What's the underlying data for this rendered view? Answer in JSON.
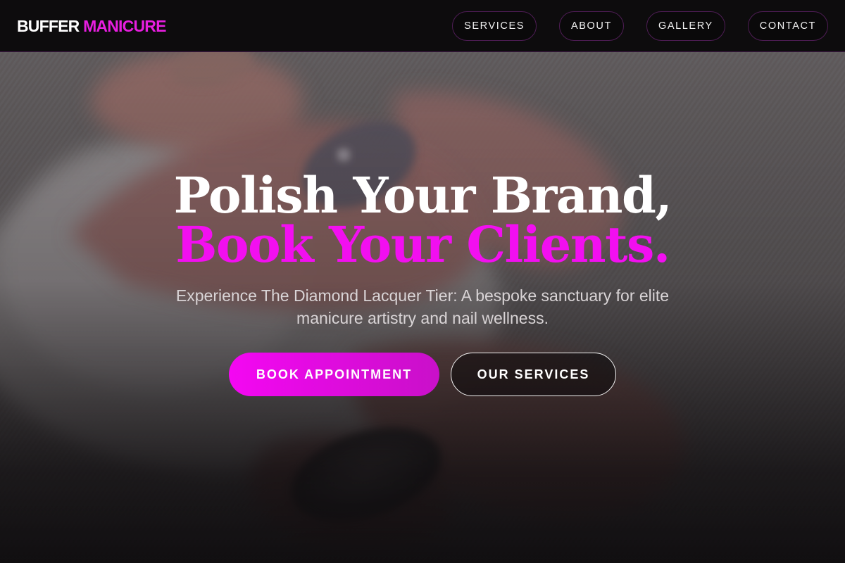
{
  "brand": {
    "name_part1": "BUFFER",
    "name_part2": "MANICURE",
    "accent_color": "#e81ee0"
  },
  "nav": {
    "items": [
      {
        "label": "SERVICES"
      },
      {
        "label": "ABOUT"
      },
      {
        "label": "GALLERY"
      },
      {
        "label": "CONTACT"
      }
    ]
  },
  "hero": {
    "background_image": "close-up photo of manicured hand with glitter nails",
    "headline_line1": "Polish Your Brand,",
    "headline_line2": "Book Your Clients.",
    "subtitle": "Experience The Diamond Lacquer Tier: A bespoke sanctuary for elite manicure artistry and nail wellness.",
    "primary_cta": "BOOK APPOINTMENT",
    "secondary_cta": "OUR SERVICES"
  },
  "colors": {
    "header_bg": "#0d0c0d",
    "accent_pink": "#f20ff0",
    "text_white": "#ffffff"
  }
}
